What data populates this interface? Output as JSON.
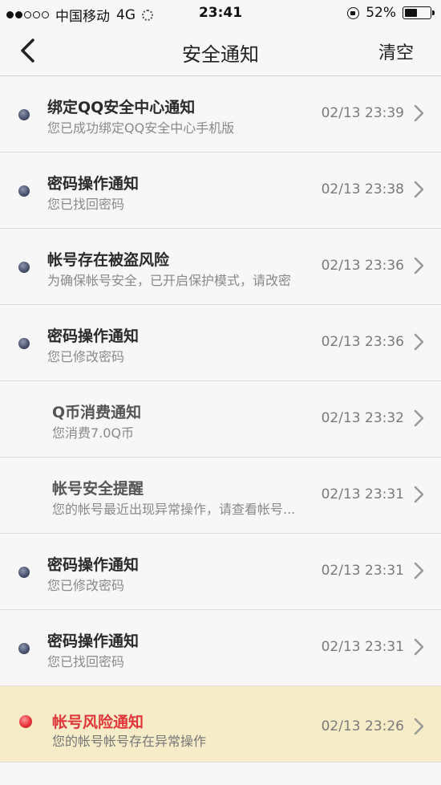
{
  "status_bar": {
    "carrier": "中国移动",
    "network": "4G",
    "time": "23:41",
    "battery": "52%",
    "battery_level": 0.52
  },
  "nav": {
    "title": "安全通知",
    "clear_label": "清空"
  },
  "notifications": [
    {
      "title": "绑定QQ安全中心通知",
      "subtitle": "您已成功绑定QQ安全中心手机版",
      "time": "02/13 23:39",
      "unread": true
    },
    {
      "title": "密码操作通知",
      "subtitle": "您已找回密码",
      "time": "02/13 23:38",
      "unread": true
    },
    {
      "title": "帐号存在被盗风险",
      "subtitle": "为确保帐号安全，已开启保护模式，请改密",
      "time": "02/13 23:36",
      "unread": true
    },
    {
      "title": "密码操作通知",
      "subtitle": "您已修改密码",
      "time": "02/13 23:36",
      "unread": true
    },
    {
      "title": "Q币消费通知",
      "subtitle": "您消费7.0Q币",
      "time": "02/13 23:32",
      "unread": false
    },
    {
      "title": "帐号安全提醒",
      "subtitle": "您的帐号最近出现异常操作，请查看帐号...",
      "time": "02/13 23:31",
      "unread": false
    },
    {
      "title": "密码操作通知",
      "subtitle": "您已修改密码",
      "time": "02/13 23:31",
      "unread": true
    },
    {
      "title": "密码操作通知",
      "subtitle": "您已找回密码",
      "time": "02/13 23:31",
      "unread": true
    },
    {
      "title": "帐号风险通知",
      "subtitle": "您的帐号帐号存在异常操作",
      "time": "02/13 23:26",
      "unread": true,
      "alert": true
    }
  ],
  "colors": {
    "alert_title": "#e0363a",
    "highlight_bg": "#f6ecc8",
    "unread_dot": "#4a5470",
    "alert_dot": "#e8313a"
  }
}
